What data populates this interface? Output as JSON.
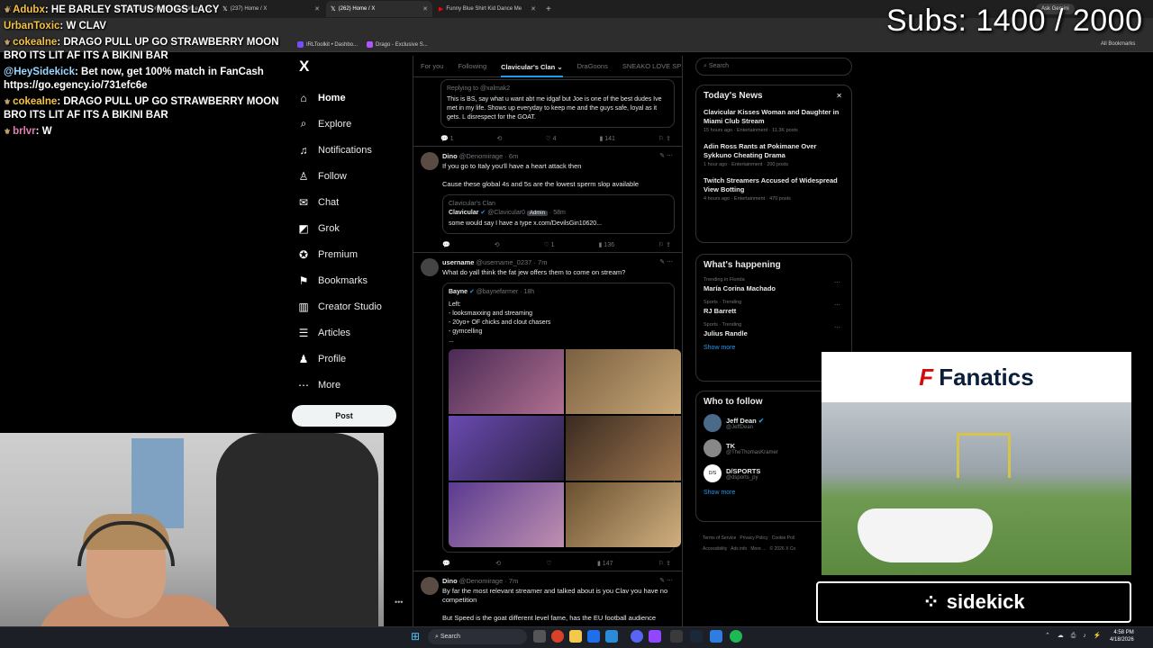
{
  "browser": {
    "tabs": [
      {
        "label": "",
        "active": false
      },
      {
        "label": "(204) Sultry on X: \"Drago, since",
        "active": false
      },
      {
        "label": "(237) Home / X",
        "active": false
      },
      {
        "label": "(262) Home / X",
        "active": true
      },
      {
        "label": "Funny Blue Shirt Kid Dance Me",
        "active": false
      }
    ],
    "new_tab": "+",
    "ask_gemini": "Ask Gemini",
    "bookmarks": [
      "IRLToolkit • Dashbo...",
      "Drago - Exclusive S..."
    ],
    "all_bookmarks": "All Bookmarks"
  },
  "stream_overlay": {
    "subs": "Subs: 1400 / 2000",
    "chat": [
      {
        "user": "Adubx",
        "text": "HE BARLEY STATUS MOGS LACY"
      },
      {
        "user": "UrbanToxic",
        "text": "W CLAV"
      },
      {
        "user": "cokealne",
        "text": "DRAGO PULL UP GO STRAWBERRY MOON BRO ITS LIT AF ITS A BIKINI BAR"
      },
      {
        "user": "@HeySidekick",
        "text": "Bet now, get 100% match in FanCash https://go.egency.io/731efc6e"
      },
      {
        "user": "cokealne",
        "text": "DRAGO PULL UP GO STRAWBERRY MOON BRO ITS LIT AF ITS A BIKINI BAR"
      },
      {
        "user": "brlvr",
        "text": "W"
      }
    ]
  },
  "nav": {
    "logo": "X",
    "items": [
      {
        "label": "Home",
        "icon": "⌂"
      },
      {
        "label": "Explore",
        "icon": "⌕"
      },
      {
        "label": "Notifications",
        "icon": "♫"
      },
      {
        "label": "Follow",
        "icon": "♙"
      },
      {
        "label": "Chat",
        "icon": "✉"
      },
      {
        "label": "Grok",
        "icon": "◩"
      },
      {
        "label": "Premium",
        "icon": "✪"
      },
      {
        "label": "Bookmarks",
        "icon": "⚑"
      },
      {
        "label": "Creator Studio",
        "icon": "▥"
      },
      {
        "label": "Articles",
        "icon": "☰"
      },
      {
        "label": "Profile",
        "icon": "♟"
      },
      {
        "label": "More",
        "icon": "⋯"
      }
    ],
    "post": "Post",
    "more_dots": "•••"
  },
  "feed": {
    "tabs": [
      "For you",
      "Following",
      "Clavicular's Clan ⌄",
      "DraGoons",
      "SNEAKO LOVE SP"
    ],
    "tweets": [
      {
        "replying": "Replying to @xalmak2",
        "text": "This is BS, say what u want abt me idgaf but Joe is one of the best dudes Ive met in my life. Shows up everyday to keep me and the guys safe, loyal as it gets. L disrespect for the GOAT.",
        "stats": [
          "1",
          "",
          "4",
          "141"
        ]
      },
      {
        "name": "Dino",
        "handle": "@Denomirage · 6m",
        "text1": "If you go to Italy you'll have a heart attack then",
        "text2": "Cause these global 4s and 5s are the lowest sperm slop available",
        "quote_community": "Clavicular's Clan",
        "quote_name": "Clavicular",
        "quote_handle": "@Clavicular0",
        "quote_badge": "Admin",
        "quote_time": "58m",
        "quote_text": "some would say I have a type x.com/DevilsGin10620...",
        "stats": [
          "",
          "",
          "1",
          "136"
        ]
      },
      {
        "name": "username",
        "handle": "@username_0237 · 7m",
        "text": "What do yall think the fat jew offers them to come on stream?",
        "quote_name": "Bayne",
        "quote_handle": "@baynefarmer · 18h",
        "quote_lines": [
          "Left:",
          "- looksmaxxing and streaming",
          "- 20yo+ OF chicks and clout chasers",
          "- gymcelling",
          "..."
        ],
        "stats": [
          "",
          "",
          "",
          "147"
        ]
      },
      {
        "name": "Dino",
        "handle": "@Denomirage · 7m",
        "text": "By far the most relevant streamer and talked about is you Clav you have no competition",
        "text2": "But Speed is the goat different level fame, has the EU football audience"
      }
    ]
  },
  "sidebar": {
    "search_placeholder": "Search",
    "news_title": "Today's News",
    "close": "✕",
    "news": [
      {
        "title": "Clavicular Kisses Woman and Daughter in Miami Club Stream",
        "meta": "15 hours ago · Entertainment · 11.3K posts"
      },
      {
        "title": "Adin Ross Rants at Pokimane Over Sykkuno Cheating Drama",
        "meta": "1 hour ago · Entertainment · 200 posts"
      },
      {
        "title": "Twitch Streamers Accused of Widespread View Botting",
        "meta": "4 hours ago · Entertainment · 470 posts"
      }
    ],
    "happening_title": "What's happening",
    "happening": [
      {
        "cat": "Trending in Florida",
        "name": "María Corina Machado"
      },
      {
        "cat": "Sports · Trending",
        "name": "RJ Barrett"
      },
      {
        "cat": "Sports · Trending",
        "name": "Julius Randle"
      }
    ],
    "show_more": "Show more",
    "follow_title": "Who to follow",
    "follow": [
      {
        "name": "Jeff Dean",
        "handle": "@JeffDean"
      },
      {
        "name": "TK",
        "handle": "@TheThomasKramer"
      },
      {
        "name": "D/SPORTS",
        "handle": "@dsports_py"
      }
    ],
    "footer": [
      "Terms of Service",
      "Privacy Policy",
      "Cookie Poli",
      "Accessibility",
      "Ads info",
      "More ...",
      "© 2026 X Co"
    ]
  },
  "ad": {
    "brand": "Fanatics",
    "sponsor": "sidekick"
  },
  "taskbar": {
    "search": "Search",
    "time": "4:58 PM",
    "date": "4/18/2026"
  }
}
